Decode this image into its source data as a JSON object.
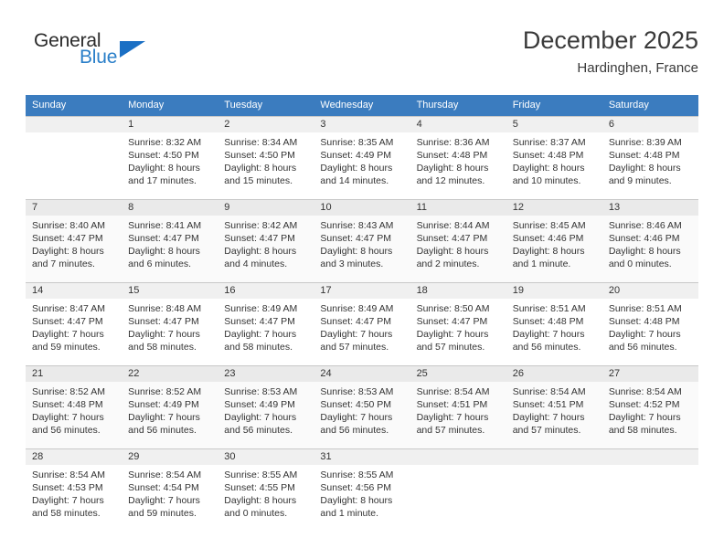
{
  "logo": {
    "general_text": "General",
    "blue_text": "Blue",
    "triangle_color": "#1a6fc4",
    "blue_color": "#2a7fc9"
  },
  "header": {
    "title": "December 2025",
    "location": "Hardinghen, France"
  },
  "theme": {
    "header_row_color": "#3b7cbf",
    "daynum_band_color": "#eeeeee",
    "text_color": "#333333"
  },
  "weekday_headers": [
    "Sunday",
    "Monday",
    "Tuesday",
    "Wednesday",
    "Thursday",
    "Friday",
    "Saturday"
  ],
  "weeks": [
    {
      "days": [
        {
          "day": "",
          "sunrise": "",
          "sunset": "",
          "daylight_1": "",
          "daylight_2": "",
          "empty": true
        },
        {
          "day": "1",
          "sunrise": "Sunrise: 8:32 AM",
          "sunset": "Sunset: 4:50 PM",
          "daylight_1": "Daylight: 8 hours",
          "daylight_2": "and 17 minutes.",
          "empty": false
        },
        {
          "day": "2",
          "sunrise": "Sunrise: 8:34 AM",
          "sunset": "Sunset: 4:50 PM",
          "daylight_1": "Daylight: 8 hours",
          "daylight_2": "and 15 minutes.",
          "empty": false
        },
        {
          "day": "3",
          "sunrise": "Sunrise: 8:35 AM",
          "sunset": "Sunset: 4:49 PM",
          "daylight_1": "Daylight: 8 hours",
          "daylight_2": "and 14 minutes.",
          "empty": false
        },
        {
          "day": "4",
          "sunrise": "Sunrise: 8:36 AM",
          "sunset": "Sunset: 4:48 PM",
          "daylight_1": "Daylight: 8 hours",
          "daylight_2": "and 12 minutes.",
          "empty": false
        },
        {
          "day": "5",
          "sunrise": "Sunrise: 8:37 AM",
          "sunset": "Sunset: 4:48 PM",
          "daylight_1": "Daylight: 8 hours",
          "daylight_2": "and 10 minutes.",
          "empty": false
        },
        {
          "day": "6",
          "sunrise": "Sunrise: 8:39 AM",
          "sunset": "Sunset: 4:48 PM",
          "daylight_1": "Daylight: 8 hours",
          "daylight_2": "and 9 minutes.",
          "empty": false
        }
      ]
    },
    {
      "days": [
        {
          "day": "7",
          "sunrise": "Sunrise: 8:40 AM",
          "sunset": "Sunset: 4:47 PM",
          "daylight_1": "Daylight: 8 hours",
          "daylight_2": "and 7 minutes.",
          "empty": false
        },
        {
          "day": "8",
          "sunrise": "Sunrise: 8:41 AM",
          "sunset": "Sunset: 4:47 PM",
          "daylight_1": "Daylight: 8 hours",
          "daylight_2": "and 6 minutes.",
          "empty": false
        },
        {
          "day": "9",
          "sunrise": "Sunrise: 8:42 AM",
          "sunset": "Sunset: 4:47 PM",
          "daylight_1": "Daylight: 8 hours",
          "daylight_2": "and 4 minutes.",
          "empty": false
        },
        {
          "day": "10",
          "sunrise": "Sunrise: 8:43 AM",
          "sunset": "Sunset: 4:47 PM",
          "daylight_1": "Daylight: 8 hours",
          "daylight_2": "and 3 minutes.",
          "empty": false
        },
        {
          "day": "11",
          "sunrise": "Sunrise: 8:44 AM",
          "sunset": "Sunset: 4:47 PM",
          "daylight_1": "Daylight: 8 hours",
          "daylight_2": "and 2 minutes.",
          "empty": false
        },
        {
          "day": "12",
          "sunrise": "Sunrise: 8:45 AM",
          "sunset": "Sunset: 4:46 PM",
          "daylight_1": "Daylight: 8 hours",
          "daylight_2": "and 1 minute.",
          "empty": false
        },
        {
          "day": "13",
          "sunrise": "Sunrise: 8:46 AM",
          "sunset": "Sunset: 4:46 PM",
          "daylight_1": "Daylight: 8 hours",
          "daylight_2": "and 0 minutes.",
          "empty": false
        }
      ]
    },
    {
      "days": [
        {
          "day": "14",
          "sunrise": "Sunrise: 8:47 AM",
          "sunset": "Sunset: 4:47 PM",
          "daylight_1": "Daylight: 7 hours",
          "daylight_2": "and 59 minutes.",
          "empty": false
        },
        {
          "day": "15",
          "sunrise": "Sunrise: 8:48 AM",
          "sunset": "Sunset: 4:47 PM",
          "daylight_1": "Daylight: 7 hours",
          "daylight_2": "and 58 minutes.",
          "empty": false
        },
        {
          "day": "16",
          "sunrise": "Sunrise: 8:49 AM",
          "sunset": "Sunset: 4:47 PM",
          "daylight_1": "Daylight: 7 hours",
          "daylight_2": "and 58 minutes.",
          "empty": false
        },
        {
          "day": "17",
          "sunrise": "Sunrise: 8:49 AM",
          "sunset": "Sunset: 4:47 PM",
          "daylight_1": "Daylight: 7 hours",
          "daylight_2": "and 57 minutes.",
          "empty": false
        },
        {
          "day": "18",
          "sunrise": "Sunrise: 8:50 AM",
          "sunset": "Sunset: 4:47 PM",
          "daylight_1": "Daylight: 7 hours",
          "daylight_2": "and 57 minutes.",
          "empty": false
        },
        {
          "day": "19",
          "sunrise": "Sunrise: 8:51 AM",
          "sunset": "Sunset: 4:48 PM",
          "daylight_1": "Daylight: 7 hours",
          "daylight_2": "and 56 minutes.",
          "empty": false
        },
        {
          "day": "20",
          "sunrise": "Sunrise: 8:51 AM",
          "sunset": "Sunset: 4:48 PM",
          "daylight_1": "Daylight: 7 hours",
          "daylight_2": "and 56 minutes.",
          "empty": false
        }
      ]
    },
    {
      "days": [
        {
          "day": "21",
          "sunrise": "Sunrise: 8:52 AM",
          "sunset": "Sunset: 4:48 PM",
          "daylight_1": "Daylight: 7 hours",
          "daylight_2": "and 56 minutes.",
          "empty": false
        },
        {
          "day": "22",
          "sunrise": "Sunrise: 8:52 AM",
          "sunset": "Sunset: 4:49 PM",
          "daylight_1": "Daylight: 7 hours",
          "daylight_2": "and 56 minutes.",
          "empty": false
        },
        {
          "day": "23",
          "sunrise": "Sunrise: 8:53 AM",
          "sunset": "Sunset: 4:49 PM",
          "daylight_1": "Daylight: 7 hours",
          "daylight_2": "and 56 minutes.",
          "empty": false
        },
        {
          "day": "24",
          "sunrise": "Sunrise: 8:53 AM",
          "sunset": "Sunset: 4:50 PM",
          "daylight_1": "Daylight: 7 hours",
          "daylight_2": "and 56 minutes.",
          "empty": false
        },
        {
          "day": "25",
          "sunrise": "Sunrise: 8:54 AM",
          "sunset": "Sunset: 4:51 PM",
          "daylight_1": "Daylight: 7 hours",
          "daylight_2": "and 57 minutes.",
          "empty": false
        },
        {
          "day": "26",
          "sunrise": "Sunrise: 8:54 AM",
          "sunset": "Sunset: 4:51 PM",
          "daylight_1": "Daylight: 7 hours",
          "daylight_2": "and 57 minutes.",
          "empty": false
        },
        {
          "day": "27",
          "sunrise": "Sunrise: 8:54 AM",
          "sunset": "Sunset: 4:52 PM",
          "daylight_1": "Daylight: 7 hours",
          "daylight_2": "and 58 minutes.",
          "empty": false
        }
      ]
    },
    {
      "days": [
        {
          "day": "28",
          "sunrise": "Sunrise: 8:54 AM",
          "sunset": "Sunset: 4:53 PM",
          "daylight_1": "Daylight: 7 hours",
          "daylight_2": "and 58 minutes.",
          "empty": false
        },
        {
          "day": "29",
          "sunrise": "Sunrise: 8:54 AM",
          "sunset": "Sunset: 4:54 PM",
          "daylight_1": "Daylight: 7 hours",
          "daylight_2": "and 59 minutes.",
          "empty": false
        },
        {
          "day": "30",
          "sunrise": "Sunrise: 8:55 AM",
          "sunset": "Sunset: 4:55 PM",
          "daylight_1": "Daylight: 8 hours",
          "daylight_2": "and 0 minutes.",
          "empty": false
        },
        {
          "day": "31",
          "sunrise": "Sunrise: 8:55 AM",
          "sunset": "Sunset: 4:56 PM",
          "daylight_1": "Daylight: 8 hours",
          "daylight_2": "and 1 minute.",
          "empty": false
        },
        {
          "day": "",
          "sunrise": "",
          "sunset": "",
          "daylight_1": "",
          "daylight_2": "",
          "empty": true
        },
        {
          "day": "",
          "sunrise": "",
          "sunset": "",
          "daylight_1": "",
          "daylight_2": "",
          "empty": true
        },
        {
          "day": "",
          "sunrise": "",
          "sunset": "",
          "daylight_1": "",
          "daylight_2": "",
          "empty": true
        }
      ]
    }
  ]
}
